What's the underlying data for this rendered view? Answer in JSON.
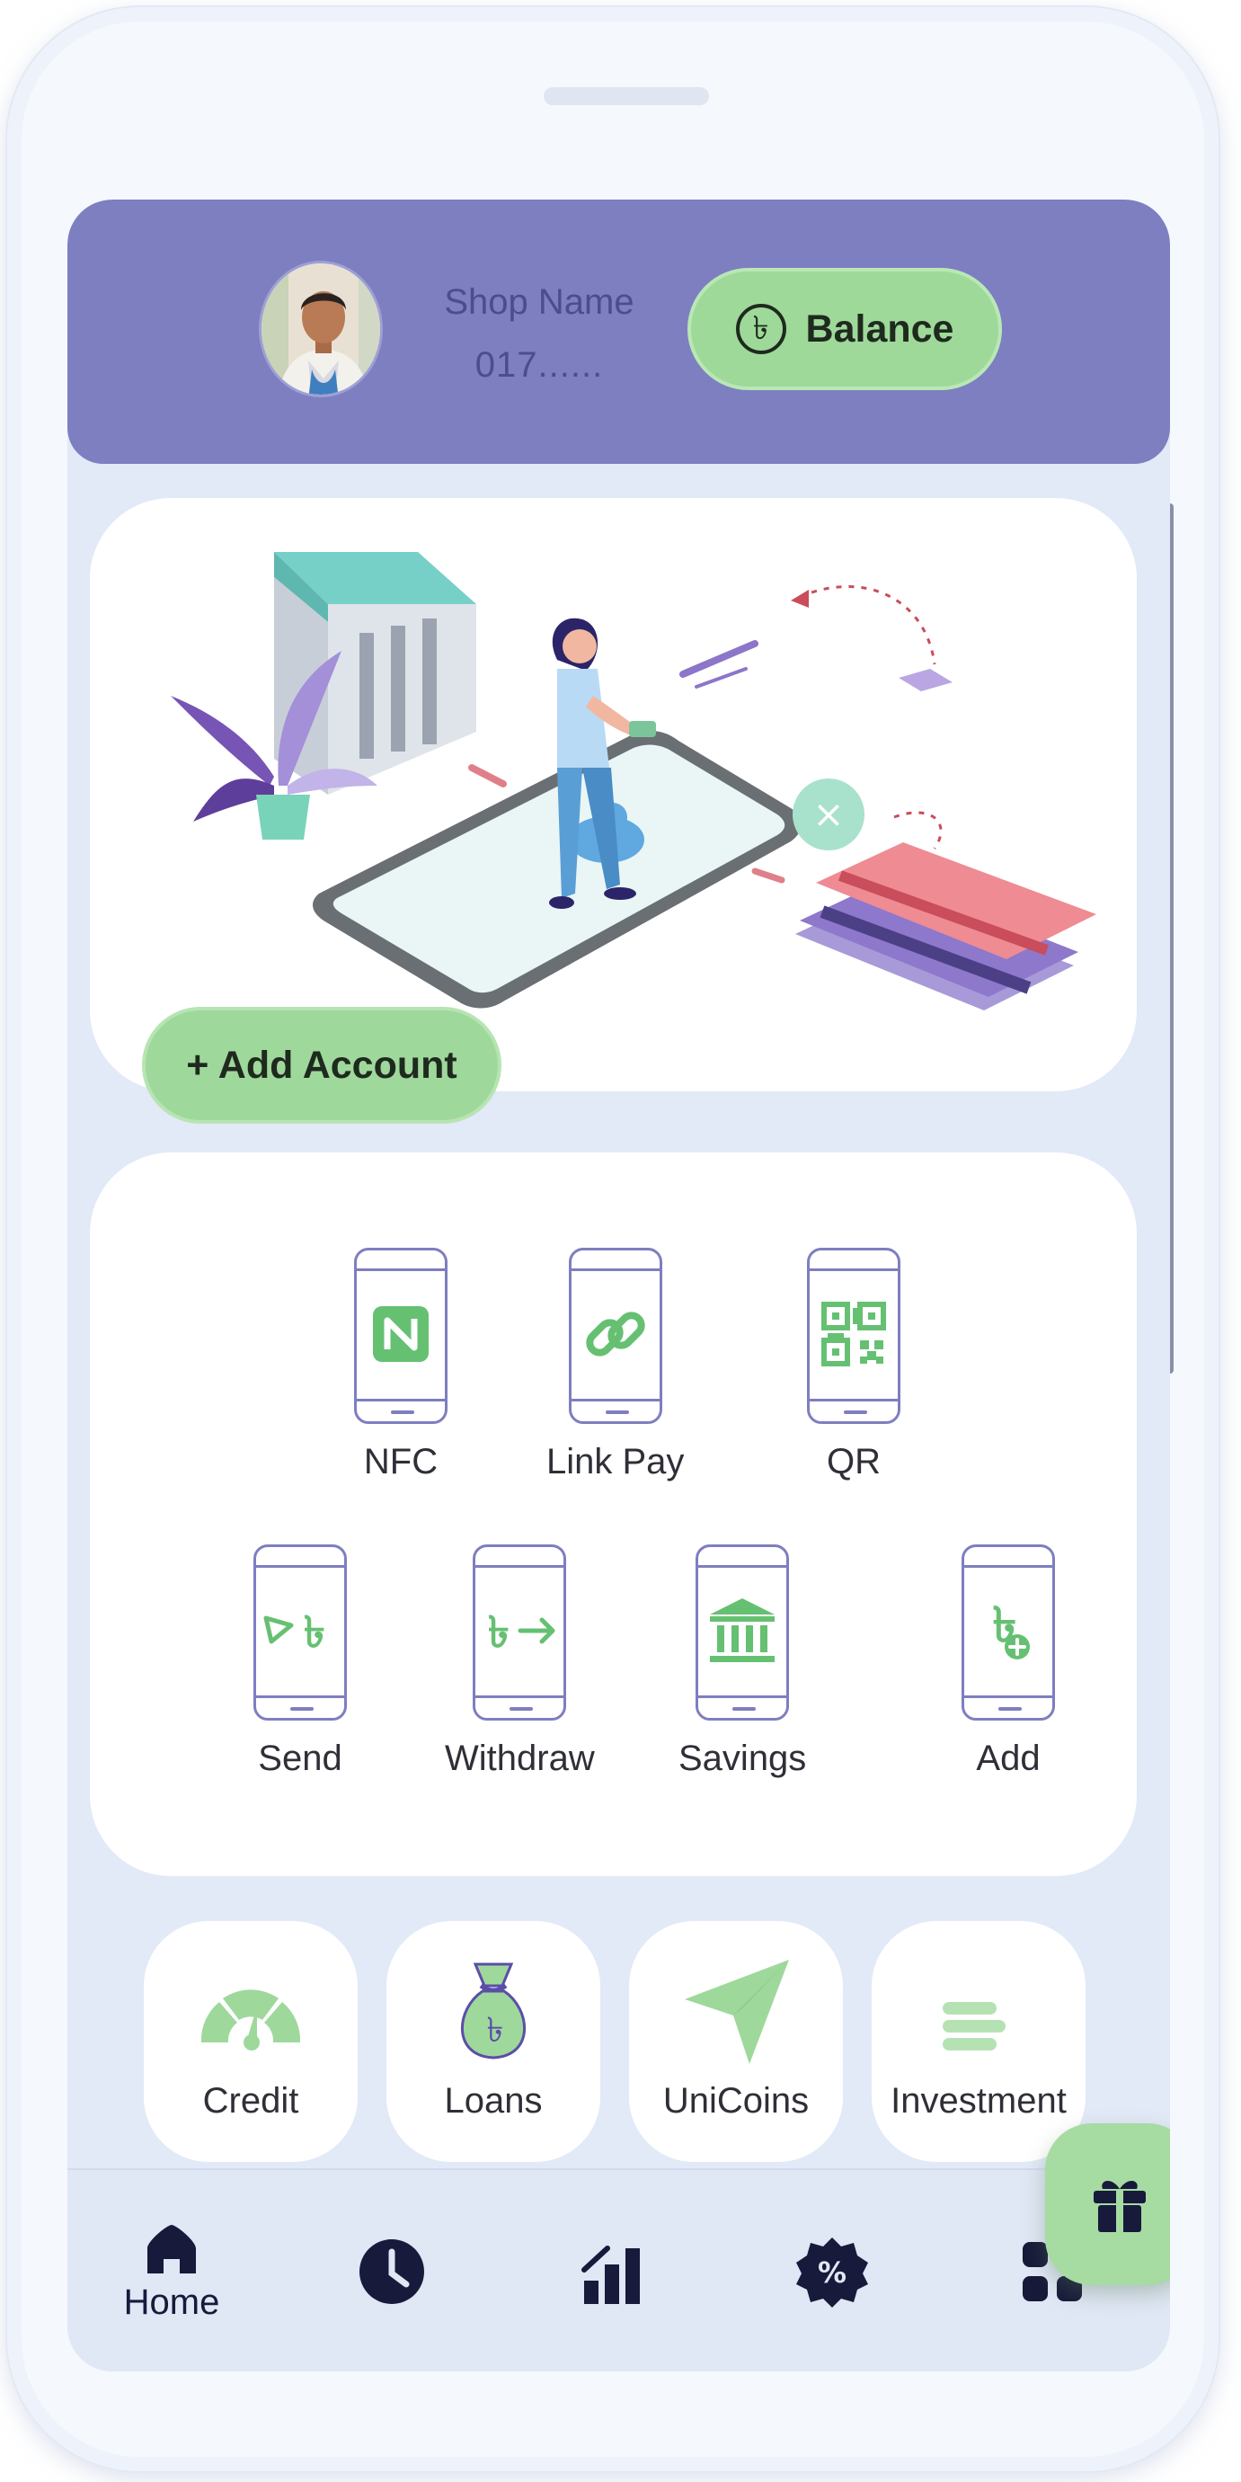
{
  "header": {
    "shop_name": "Shop Name",
    "phone": "017......",
    "balance_label": "Balance",
    "currency_symbol": "৳"
  },
  "banner": {
    "add_account_label": "+ Add Account"
  },
  "quick_actions": [
    {
      "label": "NFC",
      "icon": "nfc-icon"
    },
    {
      "label": "Link Pay",
      "icon": "link-icon"
    },
    {
      "label": "QR",
      "icon": "qr-code-icon"
    },
    {
      "label": "Send",
      "icon": "send-taka-icon"
    },
    {
      "label": "Withdraw",
      "icon": "withdraw-taka-icon"
    },
    {
      "label": "Savings",
      "icon": "bank-icon"
    },
    {
      "label": "Add",
      "icon": "add-money-icon"
    }
  ],
  "services": [
    {
      "label": "Credit",
      "icon": "gauge-icon"
    },
    {
      "label": "Loans",
      "icon": "money-bag-icon"
    },
    {
      "label": "UniCoins",
      "icon": "paper-plane-icon"
    },
    {
      "label": "Investment",
      "icon": "investment-icon"
    }
  ],
  "fab": {
    "icon": "gift-icon"
  },
  "bottom_nav": [
    {
      "label": "Home",
      "icon": "home-icon",
      "active": true
    },
    {
      "label": "",
      "icon": "clock-icon"
    },
    {
      "label": "",
      "icon": "bar-chart-icon"
    },
    {
      "label": "",
      "icon": "percent-badge-icon"
    },
    {
      "label": "",
      "icon": "grid-icon"
    }
  ],
  "colors": {
    "header_bg": "#7d7fc1",
    "accent_green": "#9ed99a",
    "icon_green": "#66c072",
    "outline_purple": "#7e7ec0",
    "screen_bg": "#e2e9f7",
    "nav_icon": "#171a3a"
  }
}
